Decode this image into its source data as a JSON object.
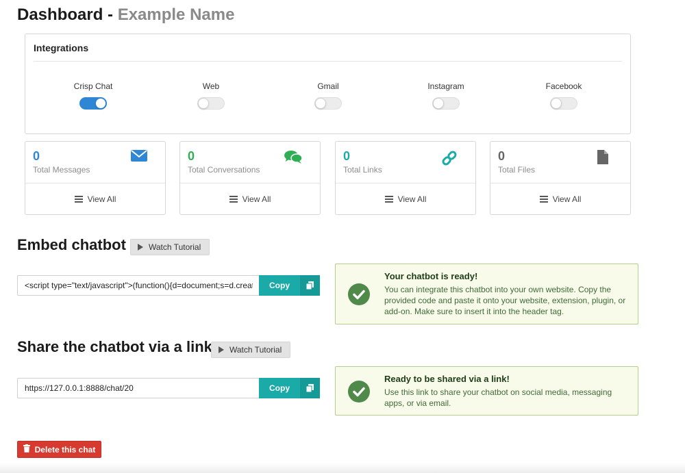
{
  "header": {
    "title": "Dashboard -",
    "name": "Example Name"
  },
  "integrations": {
    "heading": "Integrations",
    "items": [
      {
        "label": "Crisp Chat",
        "enabled": true
      },
      {
        "label": "Web",
        "enabled": false
      },
      {
        "label": "Gmail",
        "enabled": false
      },
      {
        "label": "Instagram",
        "enabled": false
      },
      {
        "label": "Facebook",
        "enabled": false
      }
    ]
  },
  "stats": [
    {
      "count": "0",
      "label": "Total Messages",
      "view_all": "View All",
      "icon": "envelope-icon",
      "color": "#2e86d4"
    },
    {
      "count": "0",
      "label": "Total Conversations",
      "view_all": "View All",
      "icon": "chat-bubbles-icon",
      "color": "#2fae53"
    },
    {
      "count": "0",
      "label": "Total Links",
      "view_all": "View All",
      "icon": "link-icon",
      "color": "#1aaba8"
    },
    {
      "count": "0",
      "label": "Total Files",
      "view_all": "View All",
      "icon": "file-icon",
      "color": "#666666"
    }
  ],
  "embed": {
    "title": "Embed chatbot",
    "tutorial_label": "Watch Tutorial",
    "code_value": "<script type=\"text/javascript\">(function(){d=document;s=d.createElement(\"script\");",
    "copy_label": "Copy",
    "note_title": "Your chatbot is ready!",
    "note_body": "You can integrate this chatbot into your own website. Copy the provided code and paste it onto your website, extension, plugin, or add-on. Make sure to insert it into the header tag."
  },
  "share": {
    "title": "Share the chatbot via a link",
    "tutorial_label": "Watch Tutorial",
    "link_value": "https://127.0.0.1:8888/chat/20",
    "copy_label": "Copy",
    "note_title": "Ready to be shared via a link!",
    "note_body": "Use this link to share your chatbot on social media, messaging apps, or via email."
  },
  "delete_label": "Delete this chat",
  "colors": {
    "accent": "#2e86d4",
    "teal": "#1aaba8",
    "success_check": "#4f8a4b",
    "danger": "#d73a2f"
  }
}
